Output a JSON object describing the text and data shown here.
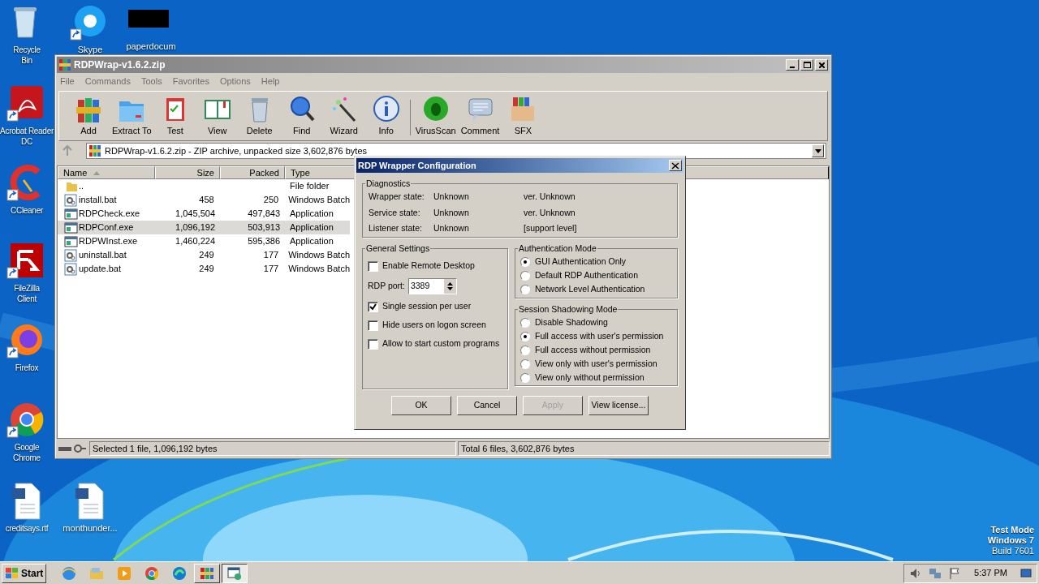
{
  "desktop_icons": [
    {
      "label": "Recycle Bin",
      "shortcut": false
    },
    {
      "label": "Skype",
      "shortcut": true
    },
    {
      "label": "paperdocum",
      "shortcut": false
    },
    {
      "label": "Acrobat Reader DC",
      "shortcut": true
    },
    {
      "label": "CCleaner",
      "shortcut": true
    },
    {
      "label": "FileZilla Client",
      "shortcut": true
    },
    {
      "label": "Firefox",
      "shortcut": true
    },
    {
      "label": "Google Chrome",
      "shortcut": true
    },
    {
      "label": "creditsays.rtf",
      "shortcut": false
    },
    {
      "label": "monthunder...",
      "shortcut": false
    }
  ],
  "window": {
    "title": "RDPWrap-v1.6.2.zip",
    "active": false,
    "menu": [
      "File",
      "Commands",
      "Tools",
      "Favorites",
      "Options",
      "Help"
    ],
    "toolbar": [
      "Add",
      "Extract To",
      "Test",
      "View",
      "Delete",
      "Find",
      "Wizard",
      "Info",
      "VirusScan",
      "Comment",
      "SFX"
    ],
    "address": "RDPWrap-v1.6.2.zip - ZIP archive, unpacked size 3,602,876 bytes",
    "columns": [
      {
        "label": "Name",
        "sorted": true
      },
      {
        "label": "Size",
        "sorted": false
      },
      {
        "label": "Packed",
        "sorted": false
      },
      {
        "label": "Type",
        "sorted": false
      }
    ],
    "rows": [
      {
        "kind": "folder",
        "name": "..",
        "size": "",
        "packed": "",
        "type": "File folder",
        "selected": false
      },
      {
        "kind": "batch",
        "name": "install.bat",
        "size": "458",
        "packed": "250",
        "type": "Windows Batch",
        "selected": false
      },
      {
        "kind": "app",
        "name": "RDPCheck.exe",
        "size": "1,045,504",
        "packed": "497,843",
        "type": "Application",
        "selected": false
      },
      {
        "kind": "app",
        "name": "RDPConf.exe",
        "size": "1,096,192",
        "packed": "503,913",
        "type": "Application",
        "selected": true
      },
      {
        "kind": "app",
        "name": "RDPWInst.exe",
        "size": "1,460,224",
        "packed": "595,386",
        "type": "Application",
        "selected": false
      },
      {
        "kind": "batch",
        "name": "uninstall.bat",
        "size": "249",
        "packed": "177",
        "type": "Windows Batch",
        "selected": false
      },
      {
        "kind": "batch",
        "name": "update.bat",
        "size": "249",
        "packed": "177",
        "type": "Windows Batch",
        "selected": false
      }
    ],
    "status_bar": [
      "Selected 1 file, 1,096,192 bytes",
      "Total 6 files, 3,602,876 bytes"
    ]
  },
  "dialog": {
    "title": "RDP Wrapper Configuration",
    "diagnostics": {
      "label": "Diagnostics",
      "rows": [
        {
          "label": "Wrapper state:",
          "value": "Unknown",
          "extra": "ver. Unknown"
        },
        {
          "label": "Service state:",
          "value": "Unknown",
          "extra": "ver. Unknown"
        },
        {
          "label": "Listener state:",
          "value": "Unknown",
          "extra": "[support level]"
        }
      ]
    },
    "general": {
      "label": "General Settings",
      "items": [
        {
          "kind": "checkbox",
          "label": "Enable Remote Desktop",
          "checked": false
        },
        {
          "kind": "spin",
          "label": "RDP port:",
          "value": "3389"
        },
        {
          "kind": "checkbox",
          "label": "Single session per user",
          "checked": true
        },
        {
          "kind": "checkbox",
          "label": "Hide users on logon screen",
          "checked": false
        },
        {
          "kind": "checkbox",
          "label": "Allow to start custom programs",
          "checked": false
        }
      ]
    },
    "auth": {
      "label": "Authentication Mode",
      "options": [
        {
          "label": "GUI Authentication Only",
          "selected": true
        },
        {
          "label": "Default RDP Authentication",
          "selected": false
        },
        {
          "label": "Network Level Authentication",
          "selected": false
        }
      ]
    },
    "shadow": {
      "label": "Session Shadowing Mode",
      "options": [
        {
          "label": "Disable Shadowing",
          "selected": false
        },
        {
          "label": "Full access with user's permission",
          "selected": true
        },
        {
          "label": "Full access without permission",
          "selected": false
        },
        {
          "label": "View only with user's permission",
          "selected": false
        },
        {
          "label": "View only without permission",
          "selected": false
        }
      ]
    },
    "buttons": [
      {
        "label": "OK",
        "disabled": false
      },
      {
        "label": "Cancel",
        "disabled": false
      },
      {
        "label": "Apply",
        "disabled": true
      },
      {
        "label": "View license...",
        "disabled": false
      }
    ]
  },
  "taskbar": {
    "start": "Start",
    "apps": [
      {
        "selected": false
      },
      {
        "selected": false
      },
      {
        "selected": false
      },
      {
        "selected": false
      },
      {
        "selected": false
      },
      {
        "selected": false
      },
      {
        "selected": true
      }
    ],
    "clock": "5:37 PM"
  },
  "watermark_text": [
    "Test Mode",
    "Windows 7",
    "Build 7601"
  ]
}
